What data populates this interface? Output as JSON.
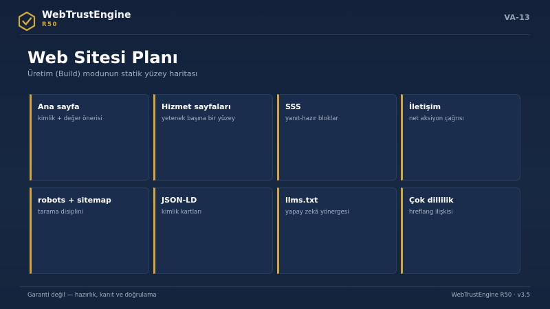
{
  "brand": {
    "name": "WebTrustEngine",
    "sub": "R50",
    "code": "VA-13",
    "accent": "#d4a93a",
    "logo_icon": "shield-check-icon"
  },
  "page": {
    "title": "Web Sitesi Planı",
    "subtitle": "Üretim (Build) modunun statik yüzey haritası"
  },
  "cards": [
    {
      "title": "Ana sayfa",
      "desc": "kimlik + değer önerisi"
    },
    {
      "title": "Hizmet sayfaları",
      "desc": "yetenek başına bir yüzey"
    },
    {
      "title": "SSS",
      "desc": "yanıt-hazır bloklar"
    },
    {
      "title": "İletişim",
      "desc": "net aksiyon çağrısı"
    },
    {
      "title": "robots + sitemap",
      "desc": "tarama disiplini"
    },
    {
      "title": "JSON-LD",
      "desc": "kimlik kartları"
    },
    {
      "title": "llms.txt",
      "desc": "yapay zekâ yönergesi"
    },
    {
      "title": "Çok dillilik",
      "desc": "hreflang ilişkisi"
    }
  ],
  "footer": {
    "left": "Garanti değil — hazırlık, kanıt ve doğrulama",
    "right": "WebTrustEngine R50 · v3.5"
  }
}
